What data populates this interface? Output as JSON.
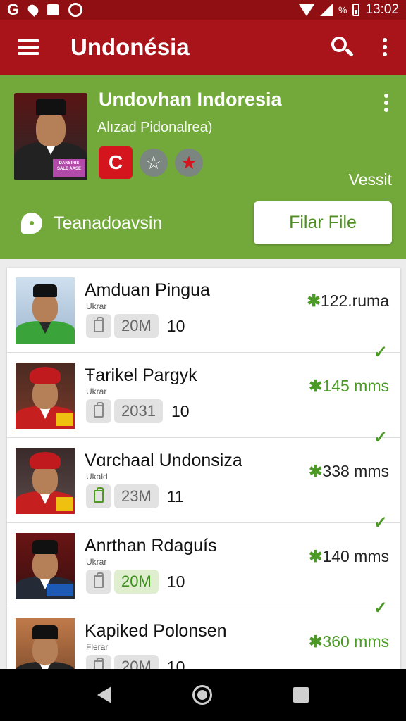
{
  "status_bar": {
    "left_glyph": "G",
    "time": "13:02",
    "battery_glyph": "%"
  },
  "app_bar": {
    "title": "Undonésia",
    "icons": [
      "menu-icon",
      "search-icon",
      "overflow-icon"
    ]
  },
  "profile": {
    "name": "Undovhan Indoresia",
    "subtitle": "Alızad Pidonalrea)",
    "photo_caption": "DANSIRIS SALE AASE",
    "badge_label": "C",
    "star_outline": "☆",
    "star_filled": "★",
    "visit_label": "Vessit",
    "chat_label": "Teanadoavsin",
    "button_label": "Filar File",
    "colors": {
      "bar": "#a9141b",
      "header": "#73a83a"
    }
  },
  "list": {
    "items": [
      {
        "name": "Amduan Pingua",
        "role": "Ukrar",
        "chip": "20M",
        "count": "10",
        "stat_icon": "✱",
        "stat": "122.ruma",
        "stat_green": false,
        "chip_green": false,
        "icon_green": false,
        "check": "✓"
      },
      {
        "name": "Ŧarikel Pargyk",
        "role": "Ukrar",
        "chip": "2031",
        "count": "10",
        "stat_icon": "✱",
        "stat": "145 mms",
        "stat_green": true,
        "chip_green": false,
        "icon_green": false,
        "check": "✓"
      },
      {
        "name": "Vɑrchaal Undonsiza",
        "role": "Ukald",
        "chip": "23M",
        "count": "11",
        "stat_icon": "✱",
        "stat": "338 mms",
        "stat_green": false,
        "chip_green": false,
        "icon_green": true,
        "check": "✓"
      },
      {
        "name": "Anrthan Rdaguís",
        "role": "Ukrar",
        "chip": "20M",
        "count": "10",
        "stat_icon": "✱",
        "stat": "140 mms",
        "stat_green": false,
        "chip_green": true,
        "icon_green": false,
        "check": "✓"
      },
      {
        "name": "Kapiked Polonsen",
        "role": "Flerar",
        "chip": "20M",
        "count": "10",
        "stat_icon": "✱",
        "stat": "360 mms",
        "stat_green": true,
        "chip_green": false,
        "icon_green": false,
        "check": ""
      }
    ]
  }
}
